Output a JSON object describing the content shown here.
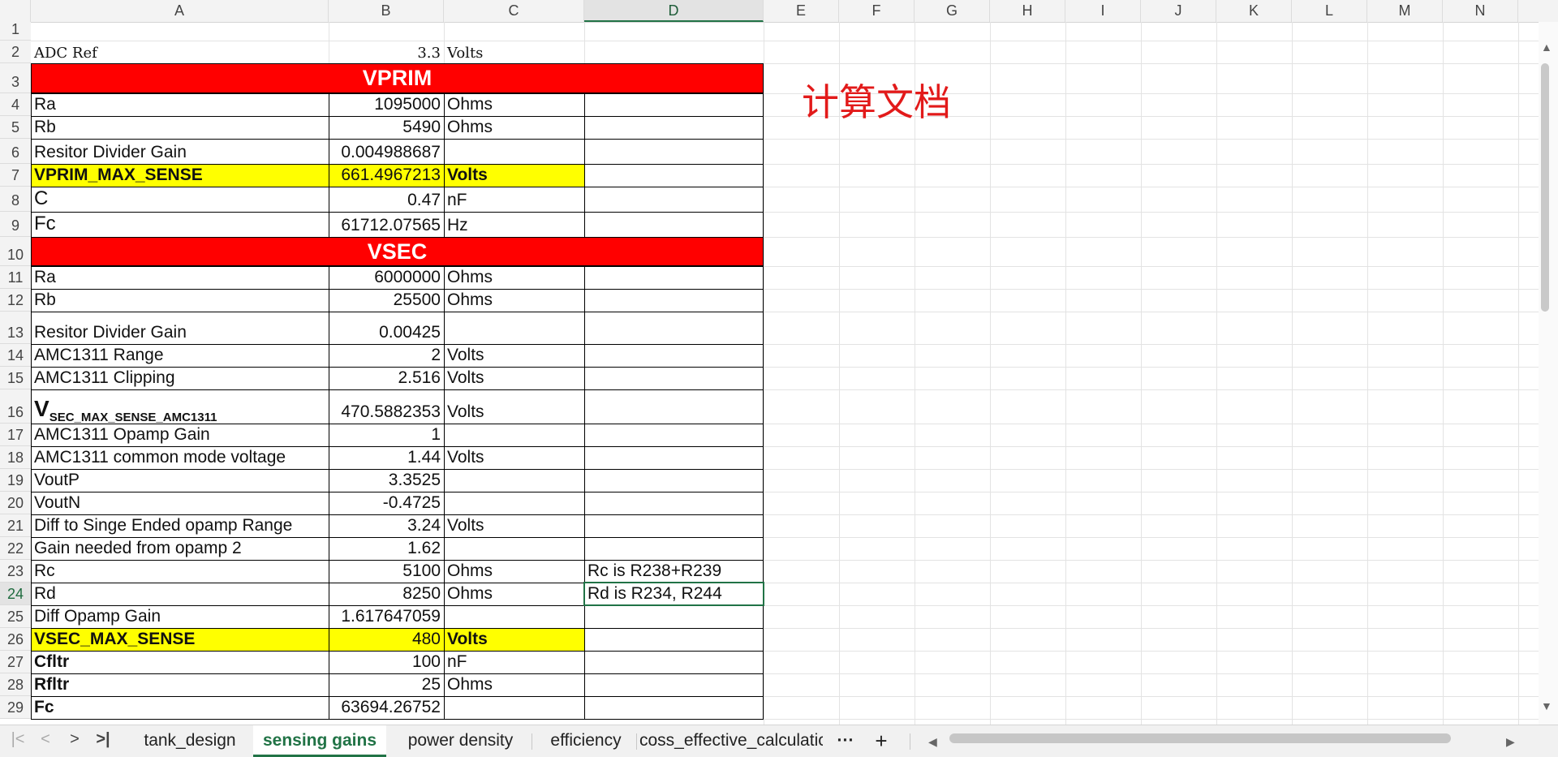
{
  "columns": [
    "A",
    "B",
    "C",
    "D",
    "E",
    "F",
    "G",
    "H",
    "I",
    "J",
    "K",
    "L",
    "M",
    "N"
  ],
  "rows": [
    "1",
    "2",
    "3",
    "4",
    "5",
    "6",
    "7",
    "8",
    "9",
    "10",
    "11",
    "12",
    "13",
    "14",
    "15",
    "16",
    "17",
    "18",
    "19",
    "20",
    "21",
    "22",
    "23",
    "24",
    "25",
    "26",
    "27",
    "28",
    "29"
  ],
  "selected_cell": "D24",
  "annotation": "计算文档",
  "cells": {
    "A2": "ADC Ref",
    "B2": "3.3",
    "C2": "Volts",
    "banner_vprim": "VPRIM",
    "A4": "Ra",
    "B4": "1095000",
    "C4": "Ohms",
    "A5": "Rb",
    "B5": "5490",
    "C5": "Ohms",
    "A6": "Resitor Divider Gain",
    "B6": "0.004988687",
    "A7": "VPRIM_MAX_SENSE",
    "B7": "661.4967213",
    "C7": "Volts",
    "A8": "C",
    "B8": "0.47",
    "C8": "nF",
    "A9": "Fc",
    "B9": "61712.07565",
    "C9": "Hz",
    "banner_vsec": "VSEC",
    "A11": "Ra",
    "B11": "6000000",
    "C11": "Ohms",
    "A12": "Rb",
    "B12": "25500",
    "C12": "Ohms",
    "A13": "Resitor Divider Gain",
    "B13": "0.00425",
    "A14": "AMC1311 Range",
    "B14": "2",
    "C14": "Volts",
    "A15": "AMC1311 Clipping",
    "B15": "2.516",
    "C15": "Volts",
    "A16_main": "V",
    "A16_sub": "SEC_MAX_SENSE_AMC1311",
    "B16": "470.5882353",
    "C16": "Volts",
    "A17": "AMC1311 Opamp Gain",
    "B17": "1",
    "A18": "AMC1311 common mode voltage",
    "B18": "1.44",
    "C18": "Volts",
    "A19": "VoutP",
    "B19": "3.3525",
    "A20": "VoutN",
    "B20": "-0.4725",
    "A21": "Diff to Singe Ended opamp Range",
    "B21": "3.24",
    "C21": "Volts",
    "A22": "Gain needed from opamp 2",
    "B22": "1.62",
    "A23": "Rc",
    "B23": "5100",
    "C23": "Ohms",
    "D23": "Rc is R238+R239",
    "A24": "Rd",
    "B24": "8250",
    "C24": "Ohms",
    "D24": "Rd is R234, R244",
    "A25": "Diff Opamp Gain",
    "B25": "1.617647059",
    "A26": "VSEC_MAX_SENSE",
    "B26": "480",
    "C26": "Volts",
    "A27": "Cfltr",
    "B27": "100",
    "C27": "nF",
    "A28": "Rfltr",
    "B28": "25",
    "C28": "Ohms",
    "A29": "Fc",
    "B29": "63694.26752"
  },
  "sheet_tabs": [
    "tank_design",
    "sensing gains",
    "power density",
    "efficiency",
    "coss_effective_calculatic"
  ],
  "active_tab": "sensing gains",
  "tab_more": "···",
  "tab_add": "+",
  "nav": {
    "first": "|<",
    "prev": "<",
    "next": ">",
    "last": ">|"
  },
  "colors": {
    "header_red": "#ff0000",
    "highlight_yellow": "#ffff00",
    "accent_green": "#217346",
    "annotation_red": "#e21a1a"
  }
}
